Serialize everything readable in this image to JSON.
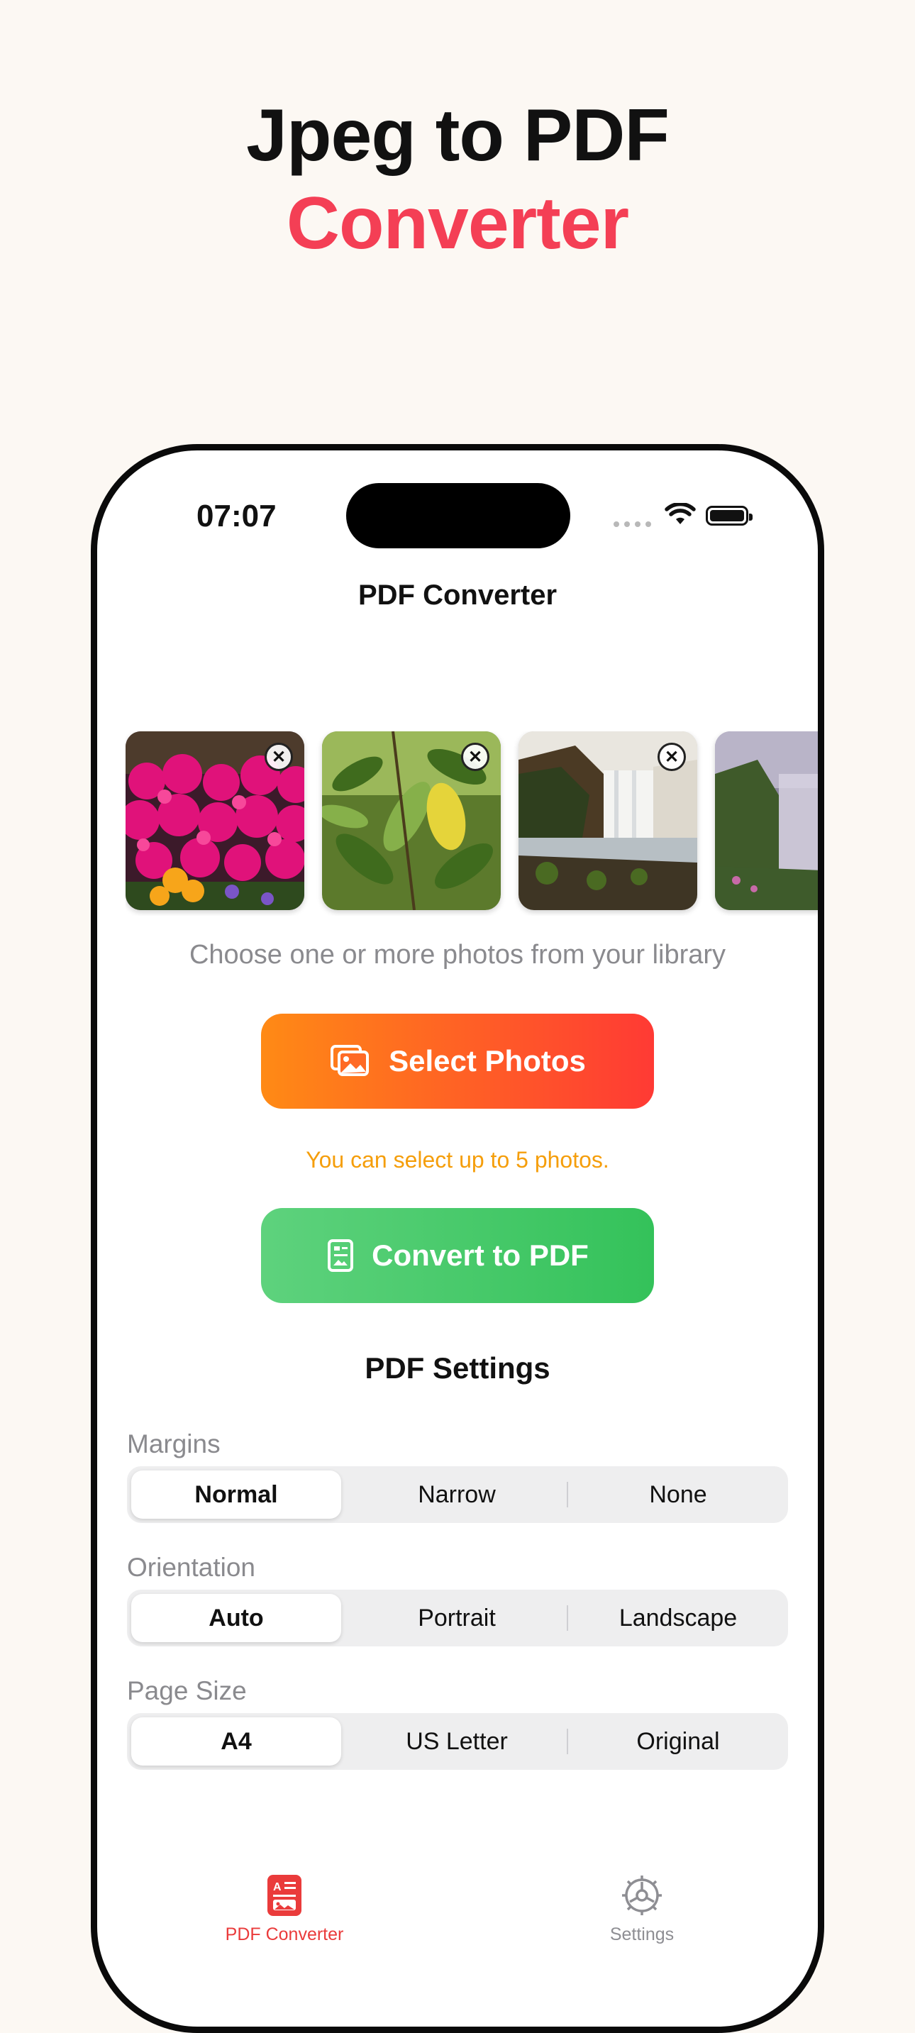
{
  "headline": {
    "line1": "Jpeg to PDF",
    "line2": "Converter"
  },
  "status_bar": {
    "time": "07:07"
  },
  "nav": {
    "title": "PDF Converter"
  },
  "photos": {
    "items": [
      {
        "subject": "magenta flowers",
        "remove_label": "✕"
      },
      {
        "subject": "green leaves",
        "remove_label": "✕"
      },
      {
        "subject": "waterfall",
        "remove_label": "✕"
      },
      {
        "subject": "misty hillside",
        "remove_label": ""
      }
    ]
  },
  "hint": "Choose one or more photos from your library",
  "select_button": {
    "label": "Select Photos",
    "icon": "photos-icon"
  },
  "limit_note": "You can select up to 5 photos.",
  "convert_button": {
    "label": "Convert to PDF",
    "icon": "document-icon"
  },
  "pdf_settings": {
    "title": "PDF Settings",
    "margins": {
      "label": "Margins",
      "options": [
        "Normal",
        "Narrow",
        "None"
      ],
      "selected": "Normal"
    },
    "orientation": {
      "label": "Orientation",
      "options": [
        "Auto",
        "Portrait",
        "Landscape"
      ],
      "selected": "Auto"
    },
    "page_size": {
      "label": "Page Size",
      "options": [
        "A4",
        "US Letter",
        "Original"
      ],
      "selected": "A4"
    }
  },
  "tab_bar": {
    "items": [
      {
        "label": "PDF Converter",
        "icon": "pdf-converter-icon",
        "active": true
      },
      {
        "label": "Settings",
        "icon": "gear-icon",
        "active": false
      }
    ]
  },
  "colors": {
    "accent_red": "#f43f55",
    "select_gradient": [
      "#ff8a15",
      "#ff3a34"
    ],
    "convert_gradient": [
      "#5ed27d",
      "#34c25a"
    ],
    "limit_note": "#f59e0b",
    "tab_active": "#ea3b3b"
  }
}
